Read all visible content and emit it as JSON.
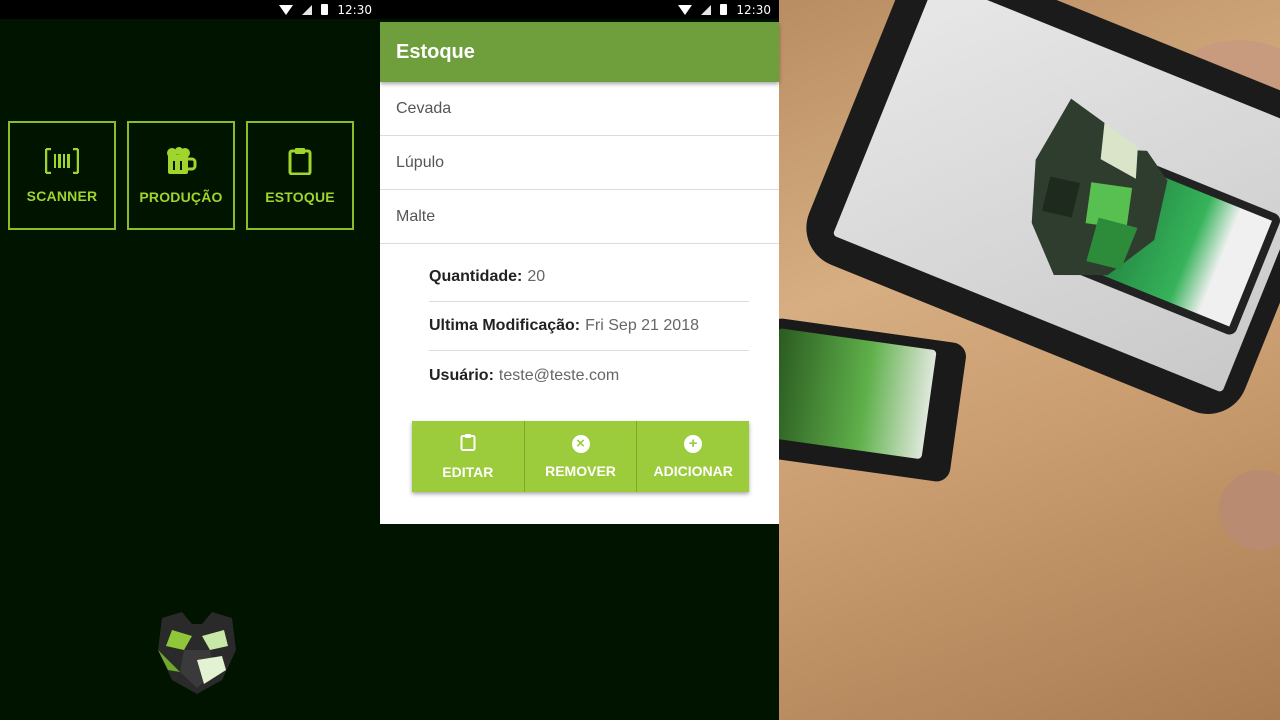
{
  "status_bar": {
    "time": "12:30"
  },
  "home": {
    "buttons": [
      {
        "label": "SCANNER",
        "icon": "barcode-icon"
      },
      {
        "label": "PRODUÇÃO",
        "icon": "beer-mug-icon"
      },
      {
        "label": "ESTOQUE",
        "icon": "clipboard-icon"
      }
    ],
    "logo": "wolf-logo"
  },
  "stock": {
    "title": "Estoque",
    "items": [
      "Cevada",
      "Lúpulo",
      "Malte"
    ],
    "details": {
      "quantity_label": "Quantidade:",
      "quantity_value": "20",
      "modified_label": "Ultima Modificação:",
      "modified_value": "Fri Sep 21 2018",
      "user_label": "Usuário:",
      "user_value": "teste@teste.com"
    },
    "actions": [
      {
        "label": "EDITAR",
        "icon": "clipboard-icon"
      },
      {
        "label": "REMOVER",
        "icon": "close-circle-icon"
      },
      {
        "label": "ADICIONAR",
        "icon": "add-circle-icon"
      }
    ]
  },
  "colors": {
    "dark_background": "#001400",
    "accent_green": "#9fd52c",
    "appbar_green": "#6f9e3d",
    "action_green": "#9ccc3c"
  }
}
